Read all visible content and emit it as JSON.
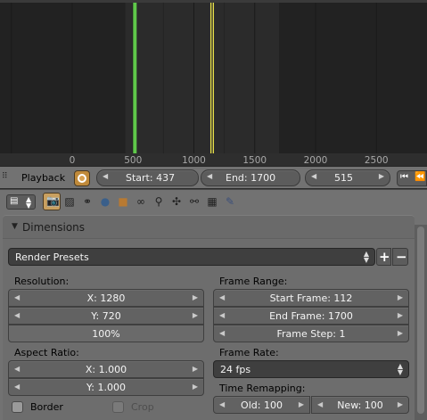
{
  "timeline": {
    "ticks": [
      "0",
      "500",
      "1000",
      "1500",
      "2000",
      "2500"
    ],
    "current_frame": 515,
    "keyframes": [
      1140,
      1160
    ]
  },
  "header": {
    "playback_label": "Playback",
    "start": "Start: 437",
    "end": "End: 1700",
    "current": "515",
    "jump_start_icon": "jump-to-start",
    "rewind_icon": "rewind"
  },
  "toolbar": {
    "icons": [
      "render",
      "render-layers",
      "scene",
      "world",
      "object",
      "constraints",
      "modifiers",
      "object-data",
      "bone",
      "bone-constraints",
      "material",
      "texture"
    ]
  },
  "dimensions": {
    "title": "Dimensions",
    "presets": "Render Presets",
    "add_icon": "+",
    "remove_icon": "−",
    "resolution_label": "Resolution:",
    "res_x": "X: 1280",
    "res_y": "Y: 720",
    "res_pct": "100%",
    "aspect_label": "Aspect Ratio:",
    "asp_x": "X: 1.000",
    "asp_y": "Y: 1.000",
    "border_label": "Border",
    "crop_label": "Crop",
    "frame_range_label": "Frame Range:",
    "start_frame": "Start Frame: 112",
    "end_frame": "End Frame: 1700",
    "frame_step": "Frame Step: 1",
    "frame_rate_label": "Frame Rate:",
    "fps": "24 fps",
    "time_remap_label": "Time Remapping:",
    "old": "Old: 100",
    "new": "New: 100"
  },
  "colors": {
    "current_frame_line": "#5fc84a",
    "keyframe_line": "#e8e04a",
    "range_dim": "#222222"
  }
}
